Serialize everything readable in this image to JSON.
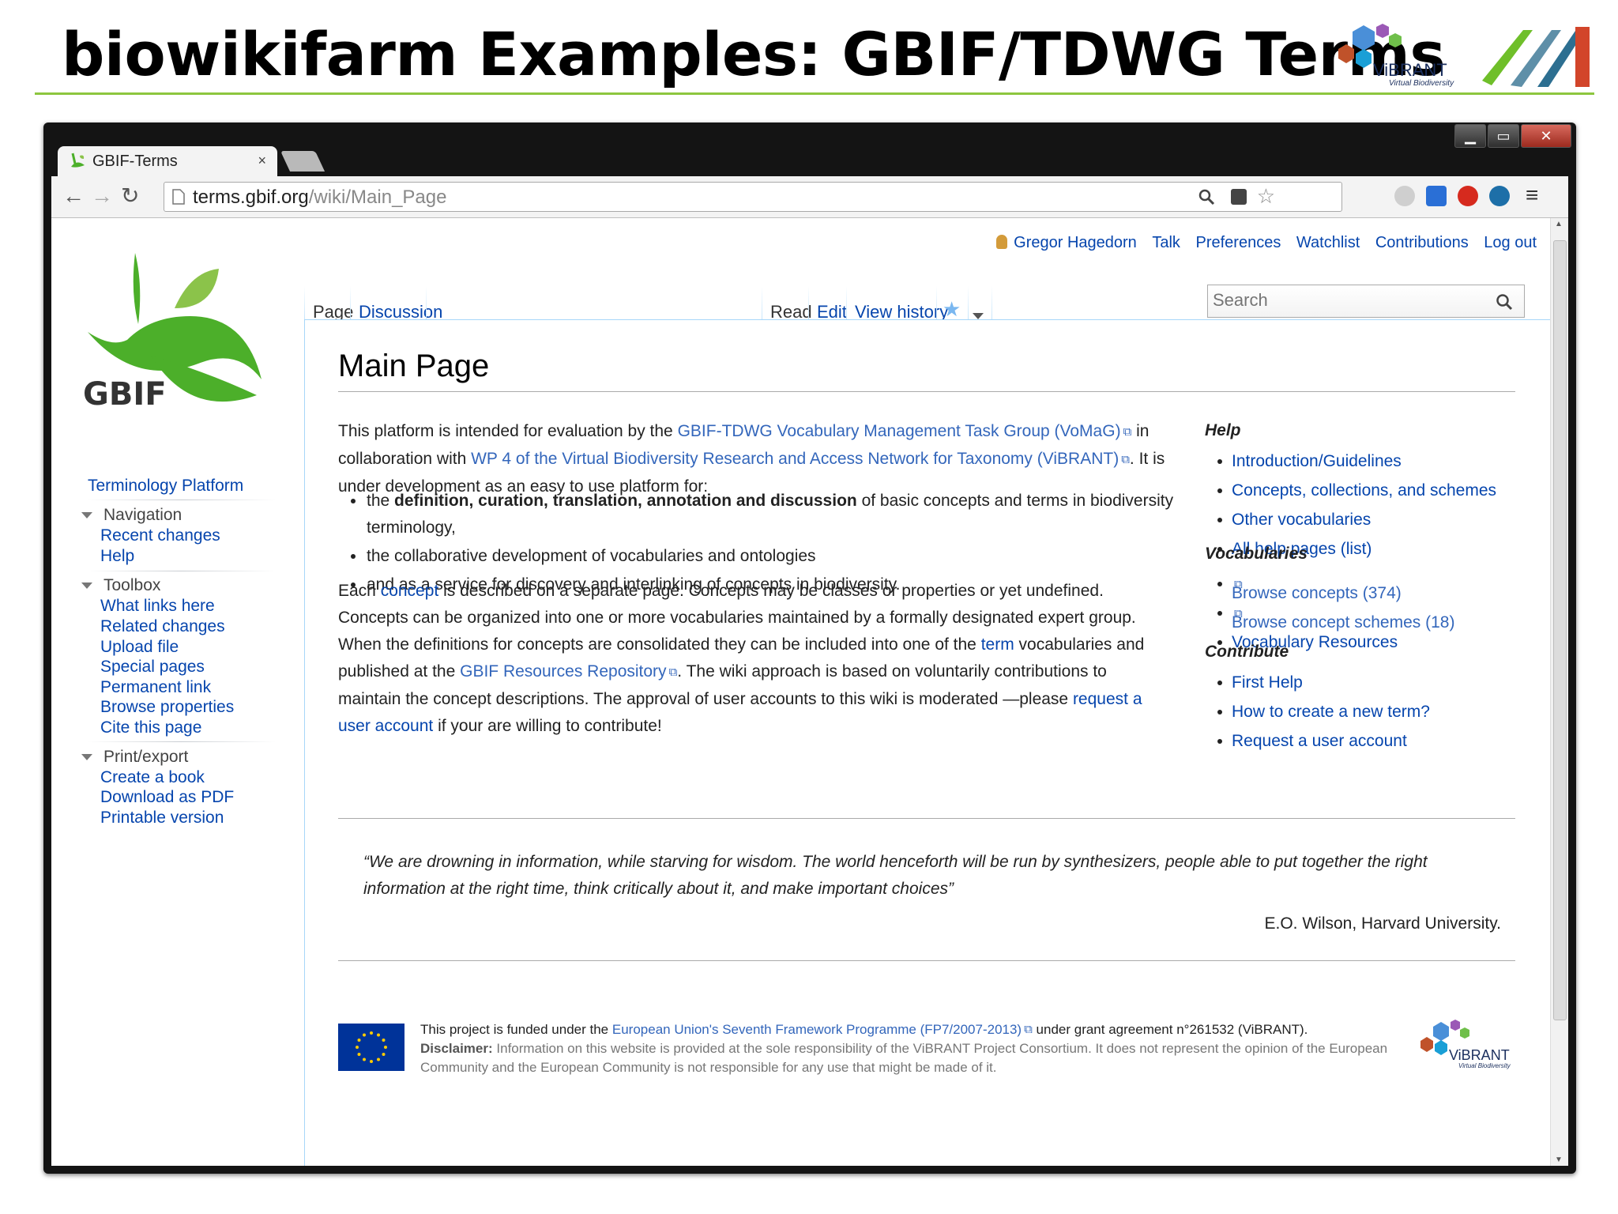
{
  "slide": {
    "title": "biowikifarm Examples: GBIF/TDWG Terms",
    "vibrant_logo_text": "ViBRANT",
    "vibrant_logo_sub": "Virtual Biodiversity"
  },
  "browser": {
    "tab_title": "GBIF-Terms",
    "tab_close": "×",
    "url_host": "terms.gbif.org",
    "url_path": "/wiki/Main_Page",
    "window_buttons": {
      "minimize": "▁",
      "maximize": "▭",
      "close": "✕"
    }
  },
  "personal_tools": {
    "user": "Gregor Hagedorn",
    "items": [
      "Talk",
      "Preferences",
      "Watchlist",
      "Contributions",
      "Log out"
    ]
  },
  "tabs": {
    "page": "Page",
    "discussion": "Discussion",
    "read": "Read",
    "edit": "Edit",
    "view_history": "View history"
  },
  "search": {
    "placeholder": "Search"
  },
  "sidebar": {
    "logo_text": "GBIF",
    "main_link": "Terminology Platform",
    "navigation": {
      "heading": "Navigation",
      "items": [
        "Recent changes",
        "Help"
      ]
    },
    "toolbox": {
      "heading": "Toolbox",
      "items": [
        "What links here",
        "Related changes",
        "Upload file",
        "Special pages",
        "Permanent link",
        "Browse properties",
        "Cite this page"
      ]
    },
    "print": {
      "heading": "Print/export",
      "items": [
        "Create a book",
        "Download as PDF",
        "Printable version"
      ]
    }
  },
  "content": {
    "title": "Main Page",
    "intro": {
      "t1": "This platform is intended for evaluation by the ",
      "l1": "GBIF-TDWG Vocabulary Management Task Group (VoMaG)",
      "t2": " in collaboration with ",
      "l2": "WP 4 of the Virtual Biodiversity Research and Access Network for Taxonomy (ViBRANT)",
      "t3": ". It is under development as an easy to use platform for:"
    },
    "bullets": {
      "b1_pre": "the ",
      "b1_bold": "definition, curation, translation, annotation and discussion",
      "b1_post": " of basic concepts and terms in biodiversity terminology,",
      "b2": "the collaborative development of vocabularies and ontologies",
      "b3": "and as a service for discovery and interlinking of concepts in biodiversity."
    },
    "para": {
      "t1": "Each ",
      "l1": "concept",
      "t2": " is described on a separate page. Concepts may be classes or properties or yet undefined. Concepts can be organized into one or more vocabularies maintained by a formally designated expert group. When the definitions for concepts are consolidated they can be included into one of the ",
      "l2": "term",
      "t3": " vocabularies and published at the ",
      "l3": "GBIF Resources Repository",
      "t4": ". The wiki approach is based on voluntarily contributions to maintain the concept descriptions. The approval of user accounts to this wiki is moderated —please ",
      "l4": "request a user account",
      "t5": " if your are willing to contribute!"
    },
    "quote": "“We are drowning in information, while starving for wisdom. The world henceforth will be run by synthesizers, people able to put together the right information at the right time, think critically about it, and make important choices”",
    "quote_attribution": "E.O. Wilson, Harvard University."
  },
  "right_panel": {
    "help": {
      "heading": "Help",
      "items": [
        "Introduction/Guidelines",
        "Concepts, collections, and schemes",
        "Other vocabularies",
        "All help pages (list)"
      ]
    },
    "vocabularies": {
      "heading": "Vocabularies",
      "items": [
        "Browse concepts (374)",
        "Browse concept schemes (18)",
        "Vocabulary Resources"
      ]
    },
    "contribute": {
      "heading": "Contribute",
      "items": [
        "First Help",
        "How to create a new term?",
        "Request a user account"
      ]
    }
  },
  "footer": {
    "funded_pre": "This project is funded under the ",
    "funded_link": "European Union's Seventh Framework Programme (FP7/2007-2013)",
    "funded_post": " under grant agreement n°261532 (ViBRANT).",
    "disclaimer_label": "Disclaimer:",
    "disclaimer_text": " Information on this website is provided at the sole responsibility of the ViBRANT Project Consortium. It does not represent the opinion of the European Community and the European Community is not responsible for any use that might be made of it.",
    "logo_text": "ViBRANT",
    "logo_sub": "Virtual Biodiversity"
  },
  "colors": {
    "link": "#0645ad",
    "external_link": "#3366bb",
    "title_rule": "#8dc63f",
    "gbif_green": "#4caf2a"
  }
}
